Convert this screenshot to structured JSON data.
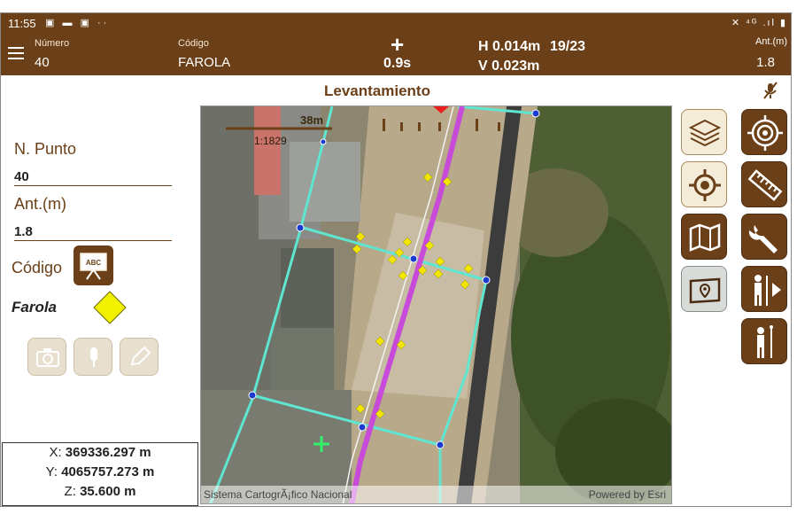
{
  "status": {
    "time": "11:55",
    "icons": "▣ ▬ ▣ ··",
    "right_icons": "✕ ⁴ᴳ .ıl ▮"
  },
  "header": {
    "numero_label": "Número",
    "numero_value": "40",
    "codigo_label": "Código",
    "codigo_value": "FAROLA",
    "time_value": "0.9s",
    "h_value": "H 0.014m",
    "satellites": "19/23",
    "v_value": "V 0.023m",
    "ant_label": "Ant.(m)",
    "ant_value": "1.8"
  },
  "title": "Levantamiento",
  "form": {
    "n_punto_label": "N. Punto",
    "n_punto_value": "40",
    "ant_label": "Ant.(m)",
    "ant_value": "1.8",
    "codigo_label": "Código",
    "code_icon_text": "ABC",
    "code_name": "Farola"
  },
  "coords": {
    "x_label": "X:",
    "x_value": "369336.297 m",
    "y_label": "Y:",
    "y_value": "4065757.273 m",
    "z_label": "Z:",
    "z_value": "35.600 m"
  },
  "map": {
    "scale_text": "38m",
    "ratio_text": "1:1829",
    "attribution_left": "Sistema CartogrÃ¡fico Nacional",
    "attribution_right": "Powered by Esri"
  },
  "colors": {
    "brand_brown": "#6b4018",
    "line_cyan": "#5fe6d0",
    "line_magenta": "#c84ad8",
    "point_yellow": "#f2e600"
  }
}
